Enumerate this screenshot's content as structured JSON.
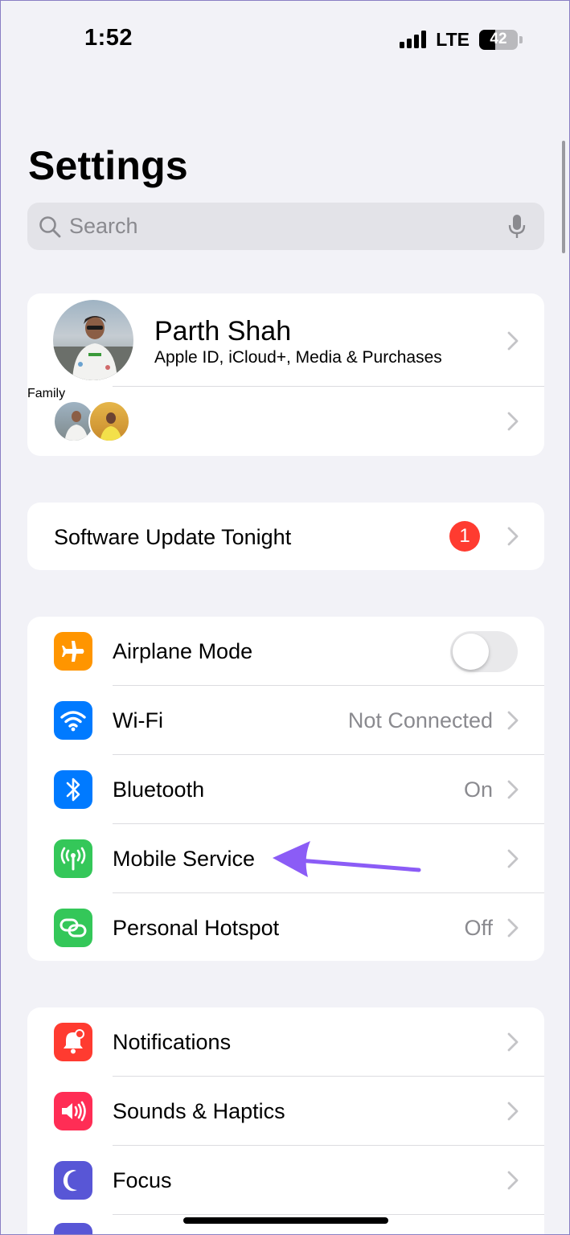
{
  "status_bar": {
    "time": "1:52",
    "network": "LTE",
    "battery": "42",
    "battery_fraction": 0.42
  },
  "header": {
    "title": "Settings"
  },
  "search": {
    "placeholder": "Search"
  },
  "profile": {
    "name": "Parth Shah",
    "subtitle": "Apple ID, iCloud+, Media & Purchases",
    "family_label": "Family"
  },
  "software_update": {
    "label": "Software Update Tonight",
    "badge": "1"
  },
  "connectivity": [
    {
      "label": "Airplane Mode",
      "icon": "airplane-icon",
      "color": "#ff9500",
      "toggle": false
    },
    {
      "label": "Wi-Fi",
      "icon": "wifi-icon",
      "color": "#007aff",
      "value": "Not Connected"
    },
    {
      "label": "Bluetooth",
      "icon": "bluetooth-icon",
      "color": "#007aff",
      "value": "On"
    },
    {
      "label": "Mobile Service",
      "icon": "antenna-icon",
      "color": "#34c759",
      "value": ""
    },
    {
      "label": "Personal Hotspot",
      "icon": "hotspot-icon",
      "color": "#34c759",
      "value": "Off"
    }
  ],
  "general": [
    {
      "label": "Notifications",
      "icon": "bell-icon",
      "color": "#ff3b30"
    },
    {
      "label": "Sounds & Haptics",
      "icon": "speaker-icon",
      "color": "#ff2d55"
    },
    {
      "label": "Focus",
      "icon": "moon-icon",
      "color": "#5856d6"
    }
  ],
  "annotation": {
    "arrow_color": "#8b5cf6"
  }
}
